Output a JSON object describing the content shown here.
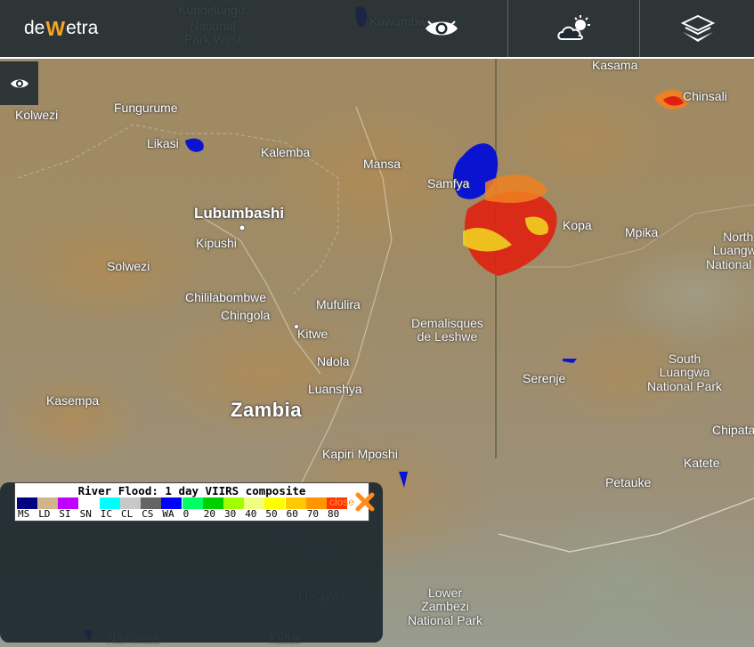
{
  "app": {
    "logo_text_left": "de",
    "logo_text_mid": "W",
    "logo_text_right": "etra"
  },
  "toolbar": {
    "eye_icon": "eye-icon",
    "weather_icon": "cloud-sun-icon",
    "layers_icon": "layers-icon"
  },
  "sidebar": {
    "eye_icon": "eye-icon"
  },
  "map": {
    "places": [
      {
        "name": "Kundelungu",
        "cls": ""
      },
      {
        "name": "National\nPark West",
        "cls": "area"
      },
      {
        "name": "Kawambwa",
        "cls": ""
      },
      {
        "name": "Kasama",
        "cls": ""
      },
      {
        "name": "Chinsali",
        "cls": ""
      },
      {
        "name": "Kolwezi",
        "cls": ""
      },
      {
        "name": "Fungurume",
        "cls": ""
      },
      {
        "name": "Likasi",
        "cls": ""
      },
      {
        "name": "Kalemba",
        "cls": ""
      },
      {
        "name": "Mansa",
        "cls": ""
      },
      {
        "name": "Samfya",
        "cls": ""
      },
      {
        "name": "Lubumbashi",
        "cls": "big"
      },
      {
        "name": "Kipushi",
        "cls": ""
      },
      {
        "name": "Kopa",
        "cls": ""
      },
      {
        "name": "Mpika",
        "cls": ""
      },
      {
        "name": "North\nLuangwa\nNational Pa",
        "cls": "area"
      },
      {
        "name": "Solwezi",
        "cls": ""
      },
      {
        "name": "Chililabombwe",
        "cls": ""
      },
      {
        "name": "Mufulira",
        "cls": ""
      },
      {
        "name": "Chingola",
        "cls": ""
      },
      {
        "name": "Demalisques\nde Leshwe",
        "cls": "area"
      },
      {
        "name": "Kitwe",
        "cls": ""
      },
      {
        "name": "Ndola",
        "cls": ""
      },
      {
        "name": "South\nLuangwa\nNational Park",
        "cls": "area"
      },
      {
        "name": "Luanshya",
        "cls": ""
      },
      {
        "name": "Serenje",
        "cls": ""
      },
      {
        "name": "Kasempa",
        "cls": ""
      },
      {
        "name": "Zambia",
        "cls": "country"
      },
      {
        "name": "Chipata",
        "cls": ""
      },
      {
        "name": "Kapiri Mposhi",
        "cls": ""
      },
      {
        "name": "Katete",
        "cls": ""
      },
      {
        "name": "Petauke",
        "cls": ""
      },
      {
        "name": "Lusaka",
        "cls": ""
      },
      {
        "name": "Lower\nZambezi\nNational Park",
        "cls": "area"
      },
      {
        "name": "Namwala",
        "cls": ""
      },
      {
        "name": "Kafue",
        "cls": ""
      }
    ]
  },
  "legend": {
    "title": "River Flood: 1 day VIIRS composite",
    "close_label": "close",
    "items": [
      {
        "code": "MS",
        "color": "#000080"
      },
      {
        "code": "LD",
        "color": "#d2b48c"
      },
      {
        "code": "SI",
        "color": "#c000ff"
      },
      {
        "code": "SN",
        "color": "#ffffff"
      },
      {
        "code": "IC",
        "color": "#00ffff"
      },
      {
        "code": "CL",
        "color": "#c8c8c8"
      },
      {
        "code": "CS",
        "color": "#646464"
      },
      {
        "code": "WA",
        "color": "#0000ff"
      },
      {
        "code": "0",
        "color": "#00ff60"
      },
      {
        "code": "20",
        "color": "#00d000"
      },
      {
        "code": "30",
        "color": "#a0ff00"
      },
      {
        "code": "40",
        "color": "#f0ff80"
      },
      {
        "code": "50",
        "color": "#ffff00"
      },
      {
        "code": "60",
        "color": "#ffc800"
      },
      {
        "code": "70",
        "color": "#ff9600"
      },
      {
        "code": "80",
        "color": "#ff3200"
      }
    ]
  },
  "colors": {
    "flood_water": "#0a14d0",
    "flood_red": "#e02010",
    "flood_yellow": "#f0d020",
    "flood_orange": "#f08020",
    "accent": "#f5a623"
  }
}
